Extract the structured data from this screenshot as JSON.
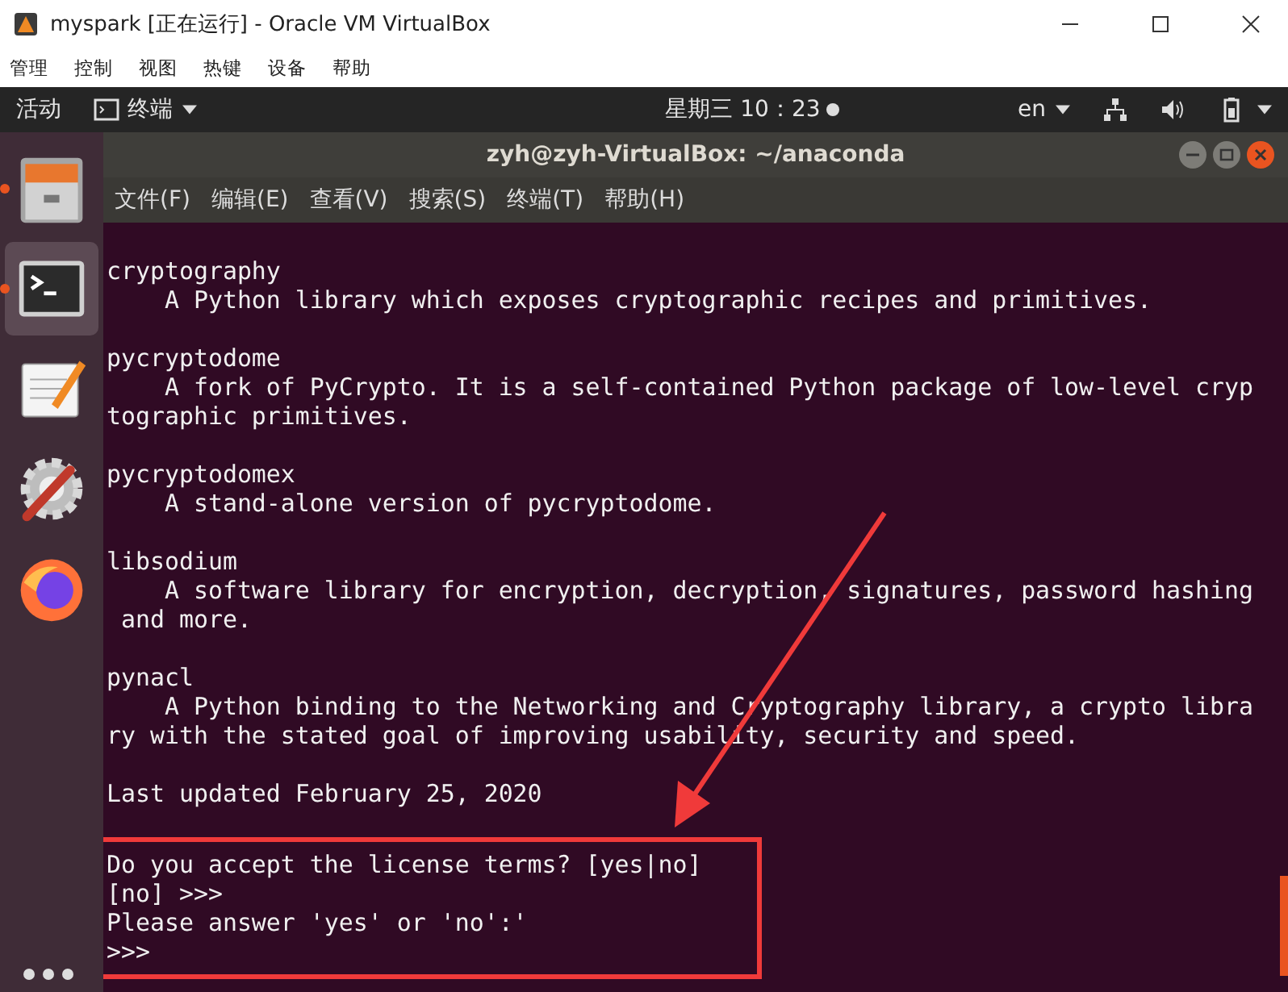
{
  "vbox": {
    "title": "myspark [正在运行] - Oracle VM VirtualBox",
    "menu": [
      "管理",
      "控制",
      "视图",
      "热键",
      "设备",
      "帮助"
    ]
  },
  "topbar": {
    "activities": "活动",
    "app": "终端",
    "clock": "星期三 10：23",
    "language": "en"
  },
  "dock": [
    {
      "kind": "files",
      "running": true,
      "selected": false
    },
    {
      "kind": "terminal",
      "running": true,
      "selected": true
    },
    {
      "kind": "editor",
      "running": false,
      "selected": false
    },
    {
      "kind": "settings",
      "running": false,
      "selected": false
    },
    {
      "kind": "browser",
      "running": false,
      "selected": false
    }
  ],
  "terminal": {
    "title": "zyh@zyh-VirtualBox: ~/anaconda",
    "menu": [
      "文件(F)",
      "编辑(E)",
      "查看(V)",
      "搜索(S)",
      "终端(T)",
      "帮助(H)"
    ],
    "blocks": [
      {
        "highlighted": false,
        "lines": [
          "cryptography",
          "    A Python library which exposes cryptographic recipes and primitives."
        ]
      },
      {
        "highlighted": false,
        "lines": [
          "pycryptodome",
          "    A fork of PyCrypto. It is a self-contained Python package of low-level cryp",
          "tographic primitives."
        ]
      },
      {
        "highlighted": false,
        "lines": [
          "pycryptodomex",
          "    A stand-alone version of pycryptodome."
        ]
      },
      {
        "highlighted": false,
        "lines": [
          "libsodium",
          "    A software library for encryption, decryption, signatures, password hashing",
          " and more."
        ]
      },
      {
        "highlighted": false,
        "lines": [
          "pynacl",
          "    A Python binding to the Networking and Cryptography library, a crypto libra",
          "ry with the stated goal of improving usability, security and speed."
        ]
      },
      {
        "highlighted": false,
        "lines": [
          "Last updated February 25, 2020"
        ]
      },
      {
        "highlighted": true,
        "lines": [
          "Do you accept the license terms? [yes|no]",
          "[no] >>>",
          "Please answer 'yes' or 'no':'",
          ">>>"
        ]
      }
    ]
  }
}
